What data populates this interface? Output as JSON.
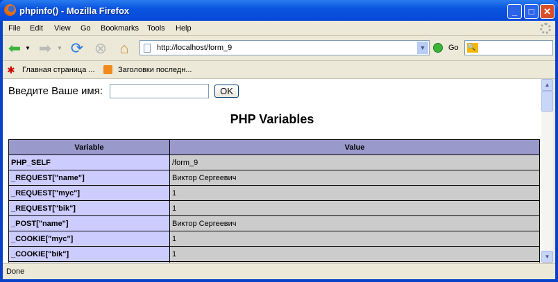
{
  "window": {
    "title": "phpinfo() - Mozilla Firefox"
  },
  "menu": [
    "File",
    "Edit",
    "View",
    "Go",
    "Bookmarks",
    "Tools",
    "Help"
  ],
  "nav": {
    "url": "http://localhost/form_9",
    "go_label": "Go",
    "search_value": ""
  },
  "bookmarks": [
    "Главная страница ...",
    "Заголовки последн..."
  ],
  "form": {
    "label": "Введите Ваше имя:",
    "input_value": "",
    "ok_label": "OK"
  },
  "page": {
    "heading": "PHP Variables"
  },
  "table": {
    "headers": [
      "Variable",
      "Value"
    ],
    "rows": [
      [
        "PHP_SELF",
        "/form_9"
      ],
      [
        "_REQUEST[\"name\"]",
        "Виктор Сергеевич"
      ],
      [
        "_REQUEST[\"myc\"]",
        "1"
      ],
      [
        "_REQUEST[\"bik\"]",
        "1"
      ],
      [
        "_POST[\"name\"]",
        "Виктор Сергеевич"
      ],
      [
        "_COOKIE[\"myc\"]",
        "1"
      ],
      [
        "_COOKIE[\"bik\"]",
        "1"
      ],
      [
        "",
        ""
      ]
    ]
  },
  "status": "Done"
}
